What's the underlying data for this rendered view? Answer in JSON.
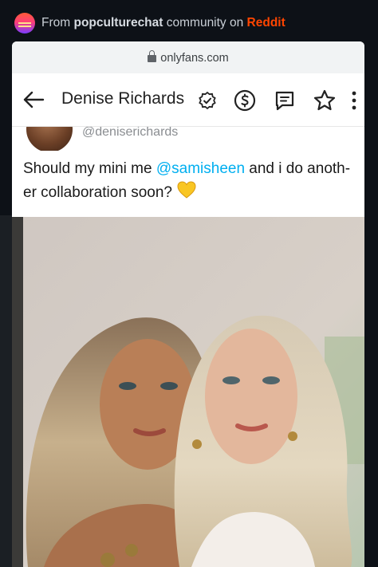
{
  "reddit": {
    "prefix": "From",
    "community": "popculturechat",
    "middle": "community on",
    "brand": "Reddit"
  },
  "browser": {
    "url": "onlyfans.com"
  },
  "profile": {
    "name": "Denise Richards",
    "handle": "@deniserichards"
  },
  "post": {
    "text_before": "Should my mini me ",
    "mention": "@samisheen",
    "text_after": " and i do anoth-er collaboration soon? ",
    "emoji": "yellow-heart"
  },
  "icons": {
    "back": "arrow-left-icon",
    "verified": "verified-badge-icon",
    "tip": "dollar-circle-icon",
    "message": "message-icon",
    "favorite": "star-icon",
    "more": "more-vertical-icon"
  },
  "colors": {
    "accent": "#00aff0",
    "reddit": "#ff4500",
    "heart": "#f9c623"
  }
}
